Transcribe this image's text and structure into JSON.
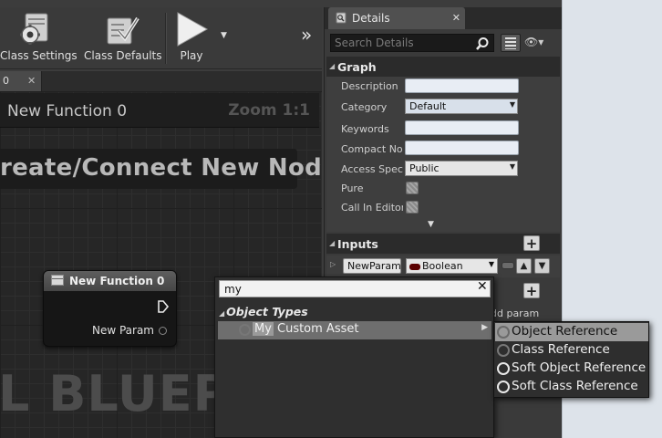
{
  "toolbar": {
    "class_settings_label": "Class Settings",
    "class_defaults_label": "Class Defaults",
    "play_label": "Play",
    "overflow_glyph": "»"
  },
  "graph": {
    "tab_label": "0",
    "title": "New Function 0",
    "zoom": "Zoom 1:1",
    "create_hint": "reate/Connect New Node",
    "watermark": "L BLUEPR"
  },
  "function_node": {
    "title": "New Function 0",
    "param_label": "New Param"
  },
  "details": {
    "tab_label": "Details",
    "search_placeholder": "Search Details",
    "graph_section": {
      "title": "Graph",
      "rows": [
        {
          "label": "Description",
          "kind": "text",
          "value": ""
        },
        {
          "label": "Category",
          "kind": "combo",
          "value": "Default"
        },
        {
          "label": "Keywords",
          "kind": "text",
          "value": ""
        },
        {
          "label": "Compact Node Title",
          "kind": "text",
          "value": ""
        },
        {
          "label": "Access Specifier",
          "kind": "combo",
          "value": "Public"
        },
        {
          "label": "Pure",
          "kind": "check",
          "value": false
        },
        {
          "label": "Call In Editor",
          "kind": "check",
          "value": false
        }
      ]
    },
    "inputs_section": {
      "title": "Inputs",
      "param_name": "NewParam",
      "param_type": "Boolean",
      "param_type_color": "#5a0000"
    },
    "outputs": {
      "add_param_text": "dd param"
    }
  },
  "type_picker": {
    "search_value": "my",
    "category": "Object Types",
    "match_highlight": "My",
    "match_rest": "Custom Asset",
    "submenu": [
      {
        "label": "Object Reference",
        "selected": true
      },
      {
        "label": "Class Reference",
        "selected": false
      },
      {
        "label": "Soft Object Reference",
        "selected": false
      },
      {
        "label": "Soft Class Reference",
        "selected": false
      }
    ]
  },
  "colors": {
    "editor_bg": "#3c3c3c",
    "graph_bg": "#262626",
    "panel_header": "#2b2b2b",
    "selection": "#9a9a9a"
  }
}
